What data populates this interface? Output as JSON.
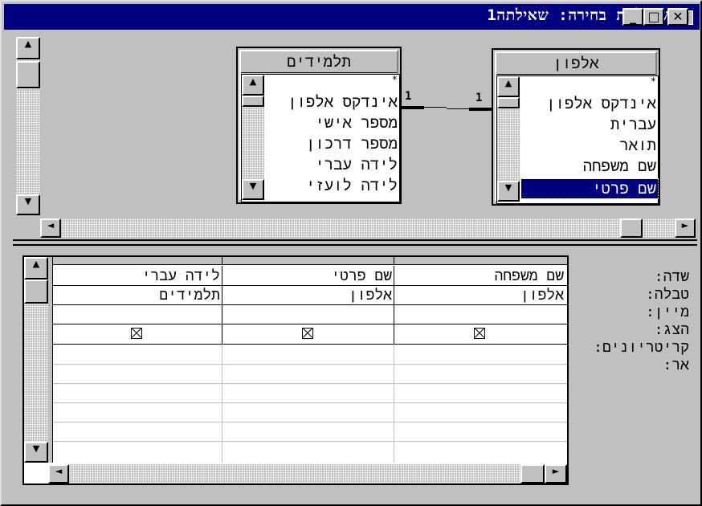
{
  "window": {
    "title": "שאילתת בחירה: שאילתה1",
    "buttons": {
      "minimize": "_",
      "maximize": "□",
      "close": "✕"
    }
  },
  "tables": [
    {
      "name": "תלמידים",
      "star": "*",
      "fields": [
        "אינדקס אלפון",
        "מספר אישי",
        "מספר דרכון",
        "לידה עברי",
        "לידה לועזי"
      ]
    },
    {
      "name": "אלפון",
      "star": "*",
      "fields": [
        "אינדקס אלפון",
        "עברית",
        "תואר",
        "שם משפחה",
        "שם פרטי"
      ],
      "selected_field": "שם פרטי"
    }
  ],
  "relationship": {
    "left_end": "1",
    "right_end": "1"
  },
  "grid": {
    "row_labels": [
      "שדה:",
      "טבלה:",
      "מיין:",
      "הצג:",
      "קריטריונים:",
      "אר:"
    ],
    "columns": [
      {
        "field": "שם משפחה",
        "table": "אלפון",
        "sort": "",
        "show": true
      },
      {
        "field": "שם פרטי",
        "table": "אלפון",
        "sort": "",
        "show": true
      },
      {
        "field": "לידה עברי",
        "table": "תלמידים",
        "sort": "",
        "show": true
      }
    ]
  },
  "icons": {
    "window": "query-icon",
    "up": "▲",
    "down": "▼",
    "left": "◄",
    "right": "►"
  }
}
